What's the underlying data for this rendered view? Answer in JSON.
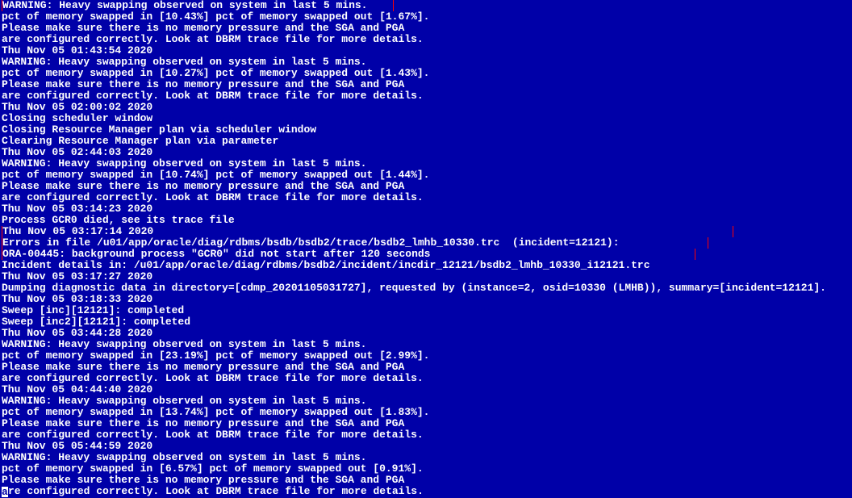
{
  "terminal": {
    "lines": [
      {
        "text": "WARNING: Heavy swapping observed on system in last 5 mins.",
        "highlight": true,
        "pad": 4
      },
      {
        "text": "pct of memory swapped in [10.43%] pct of memory swapped out [1.67%]."
      },
      {
        "text": "Please make sure there is no memory pressure and the SGA and PGA"
      },
      {
        "text": "are configured correctly. Look at DBRM trace file for more details."
      },
      {
        "text": "Thu Nov 05 01:43:54 2020"
      },
      {
        "text": "WARNING: Heavy swapping observed on system in last 5 mins."
      },
      {
        "text": "pct of memory swapped in [10.27%] pct of memory swapped out [1.43%]."
      },
      {
        "text": "Please make sure there is no memory pressure and the SGA and PGA"
      },
      {
        "text": "are configured correctly. Look at DBRM trace file for more details."
      },
      {
        "text": "Thu Nov 05 02:00:02 2020"
      },
      {
        "text": "Closing scheduler window"
      },
      {
        "text": "Closing Resource Manager plan via scheduler window"
      },
      {
        "text": "Clearing Resource Manager plan via parameter"
      },
      {
        "text": "Thu Nov 05 02:44:03 2020"
      },
      {
        "text": "WARNING: Heavy swapping observed on system in last 5 mins."
      },
      {
        "text": "pct of memory swapped in [10.74%] pct of memory swapped out [1.44%]."
      },
      {
        "text": "Please make sure there is no memory pressure and the SGA and PGA"
      },
      {
        "text": "are configured correctly. Look at DBRM trace file for more details."
      },
      {
        "text": "Thu Nov 05 03:14:23 2020"
      },
      {
        "text": "Process GCR0 died, see its trace file"
      },
      {
        "text": "Thu Nov 05 03:17:14 2020",
        "highlight": true,
        "pad": 92
      },
      {
        "text": "Errors in file /u01/app/oracle/diag/rdbms/bsdb/bsdb2/trace/bsdb2_lmhb_10330.trc  (incident=12121):",
        "highlight": true,
        "pad": 14
      },
      {
        "text": "ORA-00445: background process \"GCR0\" did not start after 120 seconds",
        "highlight": true,
        "pad": 42
      },
      {
        "text": "Incident details in: /u01/app/oracle/diag/rdbms/bsdb2/incident/incdir_12121/bsdb2_lmhb_10330_i12121.trc"
      },
      {
        "text": "Thu Nov 05 03:17:27 2020"
      },
      {
        "text": "Dumping diagnostic data in directory=[cdmp_20201105031727], requested by (instance=2, osid=10330 (LMHB)), summary=[incident=12121]."
      },
      {
        "text": "Thu Nov 05 03:18:33 2020"
      },
      {
        "text": "Sweep [inc][12121]: completed"
      },
      {
        "text": "Sweep [inc2][12121]: completed"
      },
      {
        "text": "Thu Nov 05 03:44:28 2020"
      },
      {
        "text": "WARNING: Heavy swapping observed on system in last 5 mins."
      },
      {
        "text": "pct of memory swapped in [23.19%] pct of memory swapped out [2.99%]."
      },
      {
        "text": "Please make sure there is no memory pressure and the SGA and PGA"
      },
      {
        "text": "are configured correctly. Look at DBRM trace file for more details."
      },
      {
        "text": "Thu Nov 05 04:44:40 2020"
      },
      {
        "text": "WARNING: Heavy swapping observed on system in last 5 mins."
      },
      {
        "text": "pct of memory swapped in [13.74%] pct of memory swapped out [1.83%]."
      },
      {
        "text": "Please make sure there is no memory pressure and the SGA and PGA"
      },
      {
        "text": "are configured correctly. Look at DBRM trace file for more details."
      },
      {
        "text": "Thu Nov 05 05:44:59 2020"
      },
      {
        "text": "WARNING: Heavy swapping observed on system in last 5 mins."
      },
      {
        "text": "pct of memory swapped in [6.57%] pct of memory swapped out [0.91%]."
      },
      {
        "text": "Please make sure there is no memory pressure and the SGA and PGA"
      },
      {
        "text": "are configured correctly. Look at DBRM trace file for more details.",
        "cursor": true
      }
    ]
  }
}
